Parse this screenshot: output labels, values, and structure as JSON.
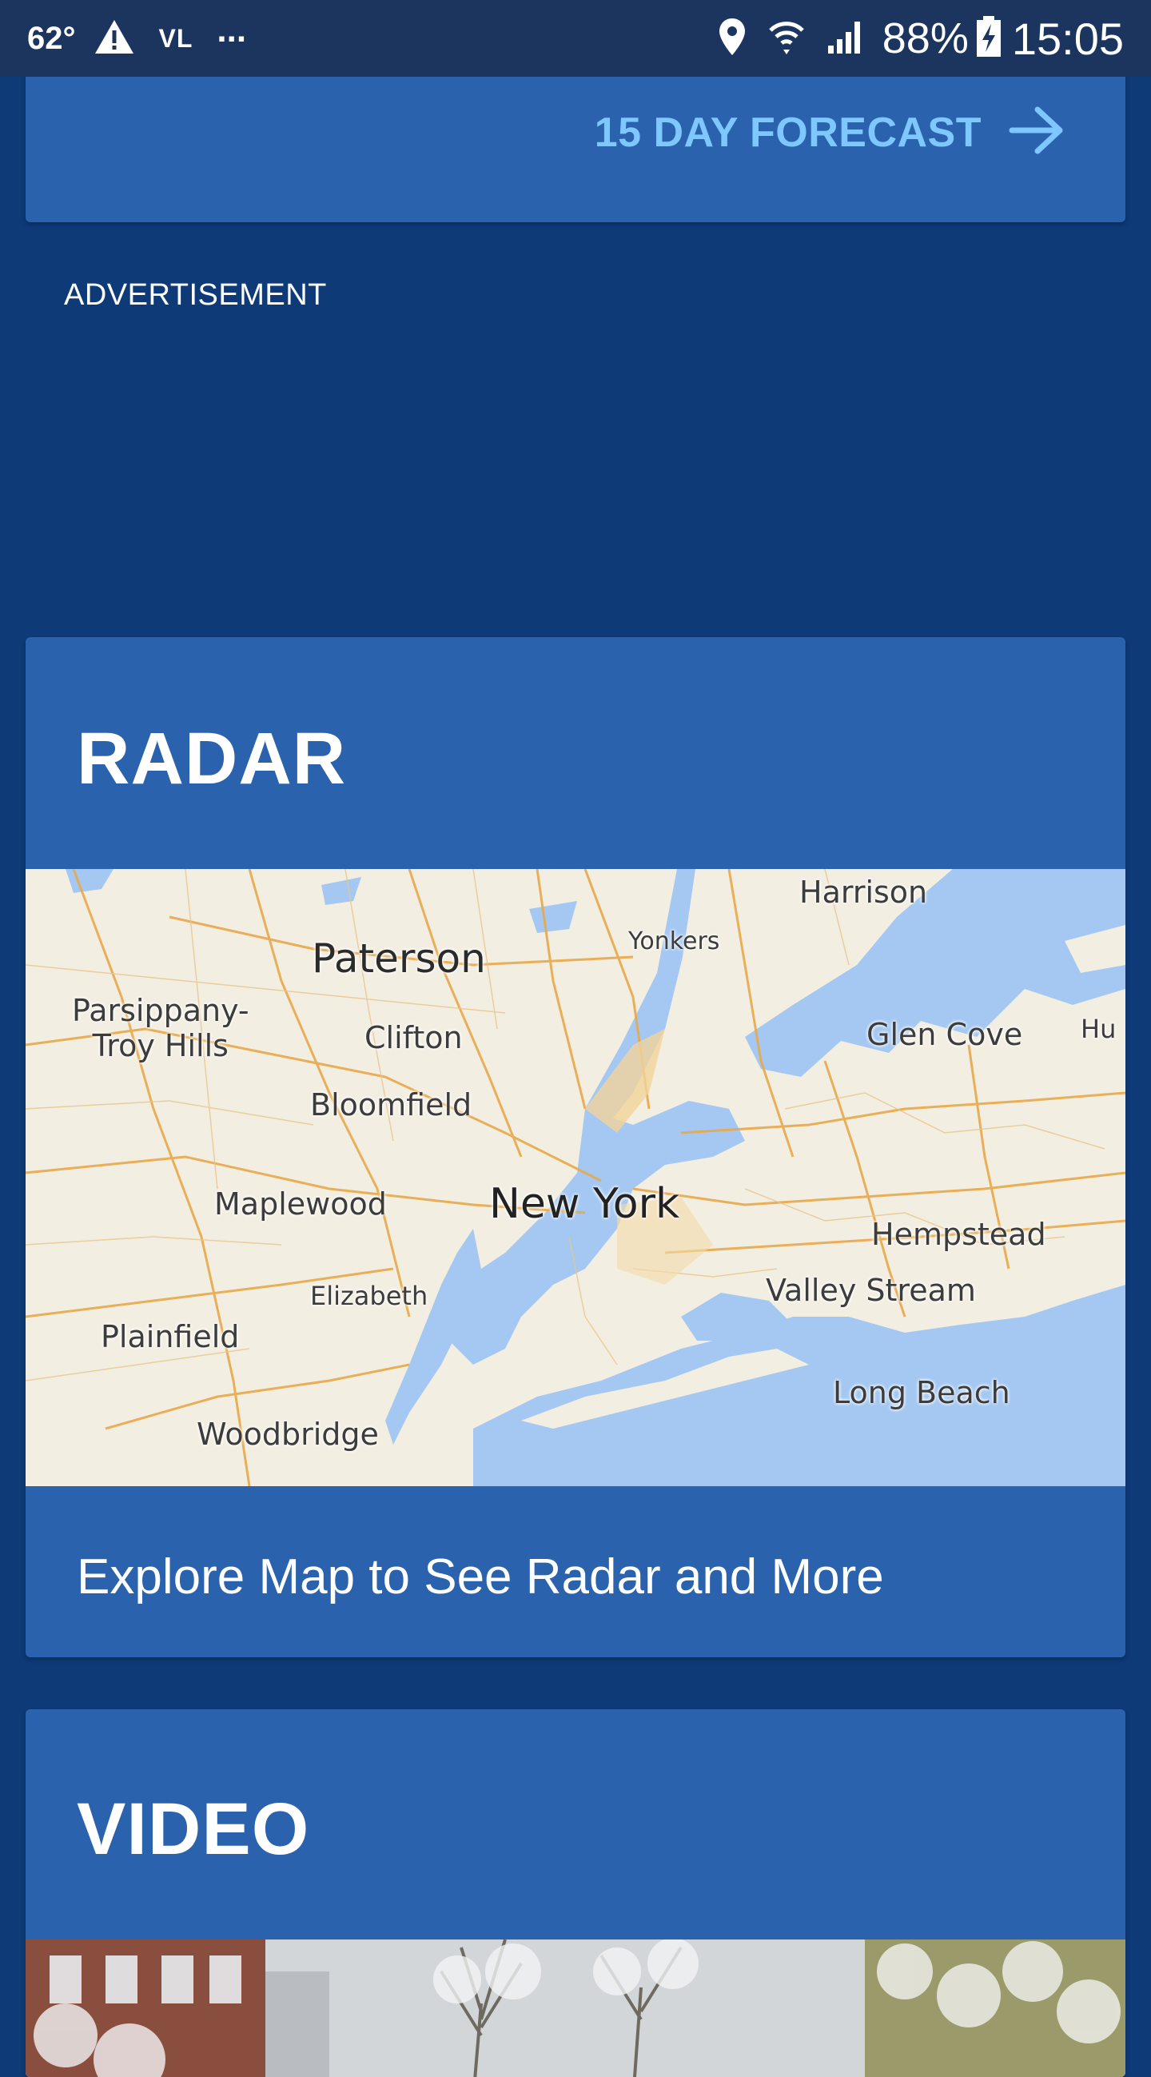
{
  "status_bar": {
    "temperature": "62°",
    "carrier": "VL",
    "more": "...",
    "battery": "88%",
    "time": "15:05"
  },
  "forecast": {
    "link_label": "15 DAY FORECAST",
    "accent_color": "#7fc7ff"
  },
  "advertisement": {
    "label": "ADVERTISEMENT"
  },
  "radar": {
    "title": "RADAR",
    "explore_label": "Explore Map to See Radar and More",
    "map_labels": {
      "harrison": "Harrison",
      "yonkers": "Yonkers",
      "paterson": "Paterson",
      "parsippany": "Parsippany-\nTroy Hills",
      "clifton": "Clifton",
      "glen_cove": "Glen Cove",
      "hu": "Hu",
      "bloomfield": "Bloomfield",
      "maplewood": "Maplewood",
      "new_york": "New York",
      "hempstead": "Hempstead",
      "elizabeth": "Elizabeth",
      "valley_stream": "Valley Stream",
      "plainfield": "Plainfield",
      "long_beach": "Long Beach",
      "woodbridge": "Woodbridge"
    }
  },
  "video": {
    "title": "VIDEO"
  },
  "colors": {
    "page_background": "#0e3a78",
    "card_background": "#2a62ad",
    "status_bar": "#1c355f",
    "water": "#a4c8f2",
    "land": "#f3eee2",
    "roads": "#e8a94a"
  }
}
